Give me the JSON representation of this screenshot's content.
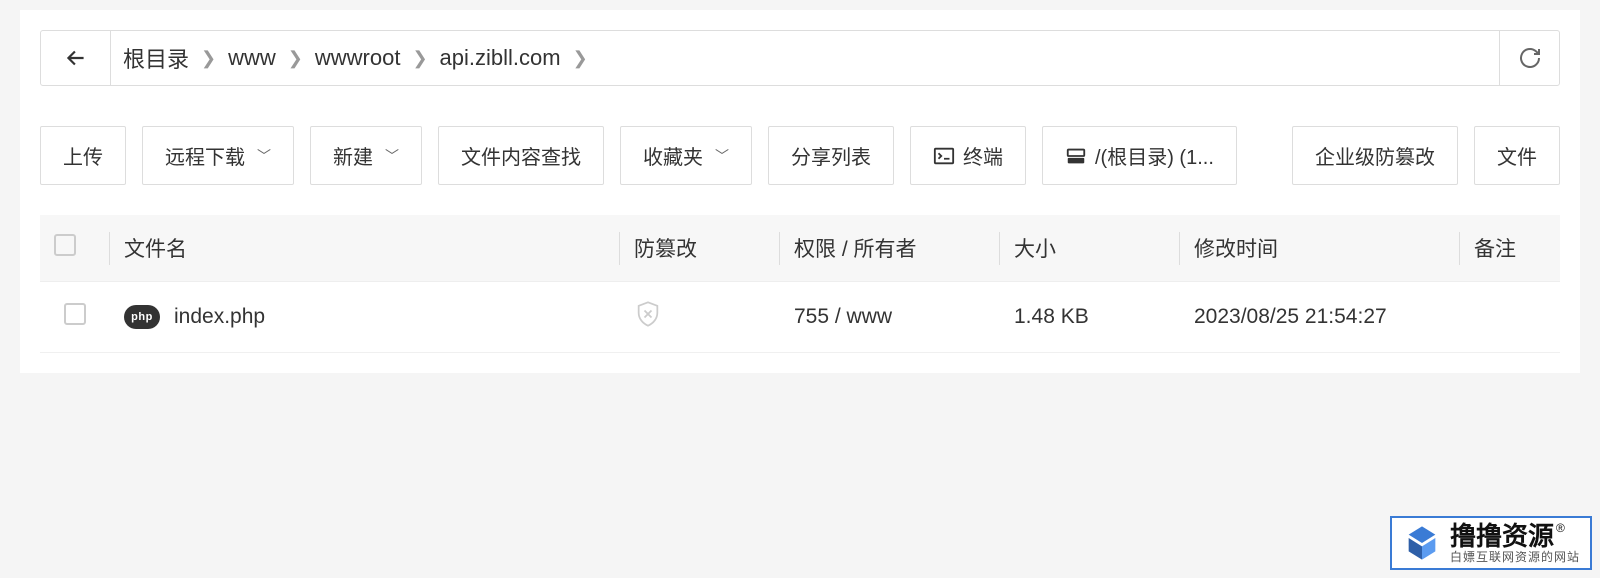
{
  "breadcrumb": {
    "items": [
      "根目录",
      "www",
      "wwwroot",
      "api.zibll.com"
    ]
  },
  "toolbar": {
    "upload": "上传",
    "remote_download": "远程下载",
    "create": "新建",
    "search": "文件内容查找",
    "favorites": "收藏夹",
    "share_list": "分享列表",
    "terminal": "终端",
    "root_path": "/(根目录) (1...",
    "tamper_proof": "企业级防篡改",
    "file_menu": "文件"
  },
  "table": {
    "headers": {
      "name": "文件名",
      "tamper": "防篡改",
      "perm": "权限 / 所有者",
      "size": "大小",
      "mtime": "修改时间",
      "note": "备注"
    },
    "rows": [
      {
        "icon": "php",
        "name": "index.php",
        "perm": "755 / www",
        "size": "1.48 KB",
        "mtime": "2023/08/25 21:54:27",
        "note": ""
      }
    ]
  },
  "watermark": {
    "title": "撸撸资源",
    "reg": "®",
    "subtitle": "白嫖互联网资源的网站"
  },
  "icons": {
    "php": "php"
  }
}
